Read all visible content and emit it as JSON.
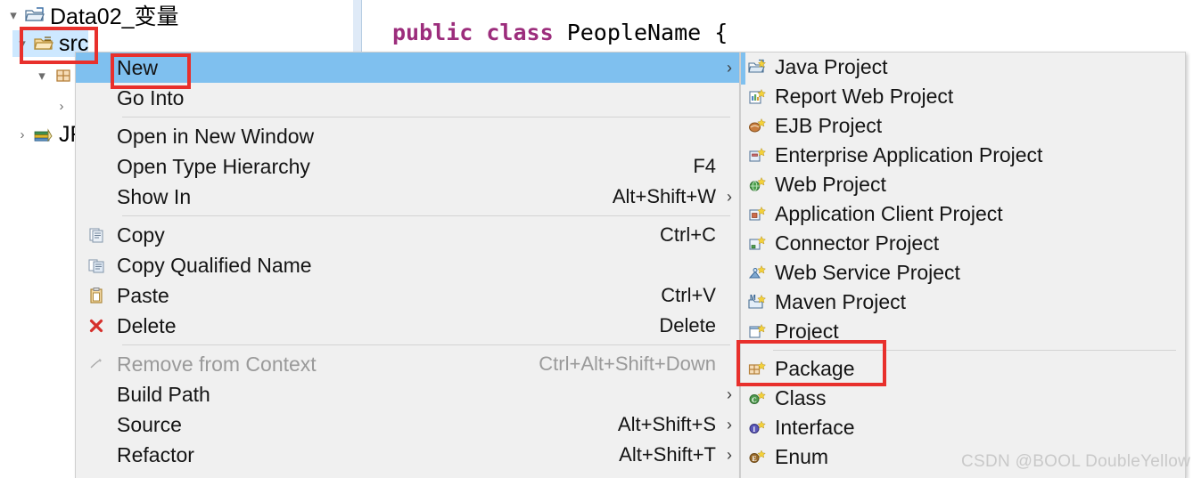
{
  "tree": {
    "rows": [
      {
        "label": "Data02_变量",
        "icon": "project-folder-icon",
        "twisty": "expanded",
        "selected": false
      },
      {
        "label": "src",
        "icon": "source-folder-icon",
        "twisty": "expanded",
        "selected": true
      },
      {
        "label": "(",
        "icon": "package-icon",
        "twisty": "expanded",
        "selected": false
      },
      {
        "label": "[",
        "icon": "java-file-icon",
        "twisty": "collapsed",
        "selected": false
      },
      {
        "label": "JR",
        "icon": "jre-library-icon",
        "twisty": "collapsed",
        "selected": false
      }
    ]
  },
  "editor": {
    "code_keyword1": "public",
    "code_keyword2": "class",
    "code_rest": " PeopleName {"
  },
  "context_menu": {
    "items": [
      {
        "label": "New",
        "accel": "",
        "icon": "",
        "arrow": true,
        "highlight": true,
        "disabled": false
      },
      {
        "label": "Go Into",
        "accel": "",
        "icon": "",
        "arrow": false,
        "highlight": false,
        "disabled": false
      },
      {
        "sep": true
      },
      {
        "label": "Open in New Window",
        "accel": "",
        "icon": "",
        "arrow": false,
        "highlight": false,
        "disabled": false
      },
      {
        "label": "Open Type Hierarchy",
        "accel": "F4",
        "icon": "",
        "arrow": false,
        "highlight": false,
        "disabled": false
      },
      {
        "label": "Show In",
        "accel": "Alt+Shift+W",
        "icon": "",
        "arrow": true,
        "highlight": false,
        "disabled": false
      },
      {
        "sep": true
      },
      {
        "label": "Copy",
        "accel": "Ctrl+C",
        "icon": "copy-icon",
        "arrow": false,
        "highlight": false,
        "disabled": false
      },
      {
        "label": "Copy Qualified Name",
        "accel": "",
        "icon": "copy-qualified-icon",
        "arrow": false,
        "highlight": false,
        "disabled": false
      },
      {
        "label": "Paste",
        "accel": "Ctrl+V",
        "icon": "paste-icon",
        "arrow": false,
        "highlight": false,
        "disabled": false
      },
      {
        "label": "Delete",
        "accel": "Delete",
        "icon": "delete-icon",
        "arrow": false,
        "highlight": false,
        "disabled": false
      },
      {
        "sep": true
      },
      {
        "label": "Remove from Context",
        "accel": "Ctrl+Alt+Shift+Down",
        "icon": "remove-context-icon",
        "arrow": false,
        "highlight": false,
        "disabled": true
      },
      {
        "label": "Build Path",
        "accel": "",
        "icon": "",
        "arrow": true,
        "highlight": false,
        "disabled": false
      },
      {
        "label": "Source",
        "accel": "Alt+Shift+S",
        "icon": "",
        "arrow": true,
        "highlight": false,
        "disabled": false
      },
      {
        "label": "Refactor",
        "accel": "Alt+Shift+T",
        "icon": "",
        "arrow": true,
        "highlight": false,
        "disabled": false
      }
    ]
  },
  "submenu": {
    "items": [
      {
        "label": "Java Project",
        "icon": "new-java-project-icon"
      },
      {
        "label": "Report Web Project",
        "icon": "new-report-web-project-icon"
      },
      {
        "label": "EJB Project",
        "icon": "new-ejb-project-icon"
      },
      {
        "label": "Enterprise Application Project",
        "icon": "new-enterprise-app-project-icon"
      },
      {
        "label": "Web Project",
        "icon": "new-web-project-icon"
      },
      {
        "label": "Application Client Project",
        "icon": "new-app-client-project-icon"
      },
      {
        "label": "Connector Project",
        "icon": "new-connector-project-icon"
      },
      {
        "label": "Web Service Project",
        "icon": "new-web-service-project-icon"
      },
      {
        "label": "Maven Project",
        "icon": "new-maven-project-icon"
      },
      {
        "label": "Project",
        "icon": "new-project-icon"
      },
      {
        "sep": true
      },
      {
        "label": "Package",
        "icon": "new-package-icon"
      },
      {
        "label": "Class",
        "icon": "new-class-icon"
      },
      {
        "label": "Interface",
        "icon": "new-interface-icon"
      },
      {
        "label": "Enum",
        "icon": "new-enum-icon"
      }
    ]
  },
  "annotations": {
    "color": "#e8302c",
    "boxes": [
      "src-tree-item",
      "new-menu-item",
      "package-submenu-item"
    ]
  },
  "watermark": {
    "text": "CSDN @BOOL DoubleYellow"
  },
  "colors": {
    "menu_bg": "#f0f0f0",
    "highlight": "#7fc0ef",
    "tree_selection": "#cde8ff",
    "keyword": "#9c2d7c",
    "annotation": "#e8302c"
  }
}
